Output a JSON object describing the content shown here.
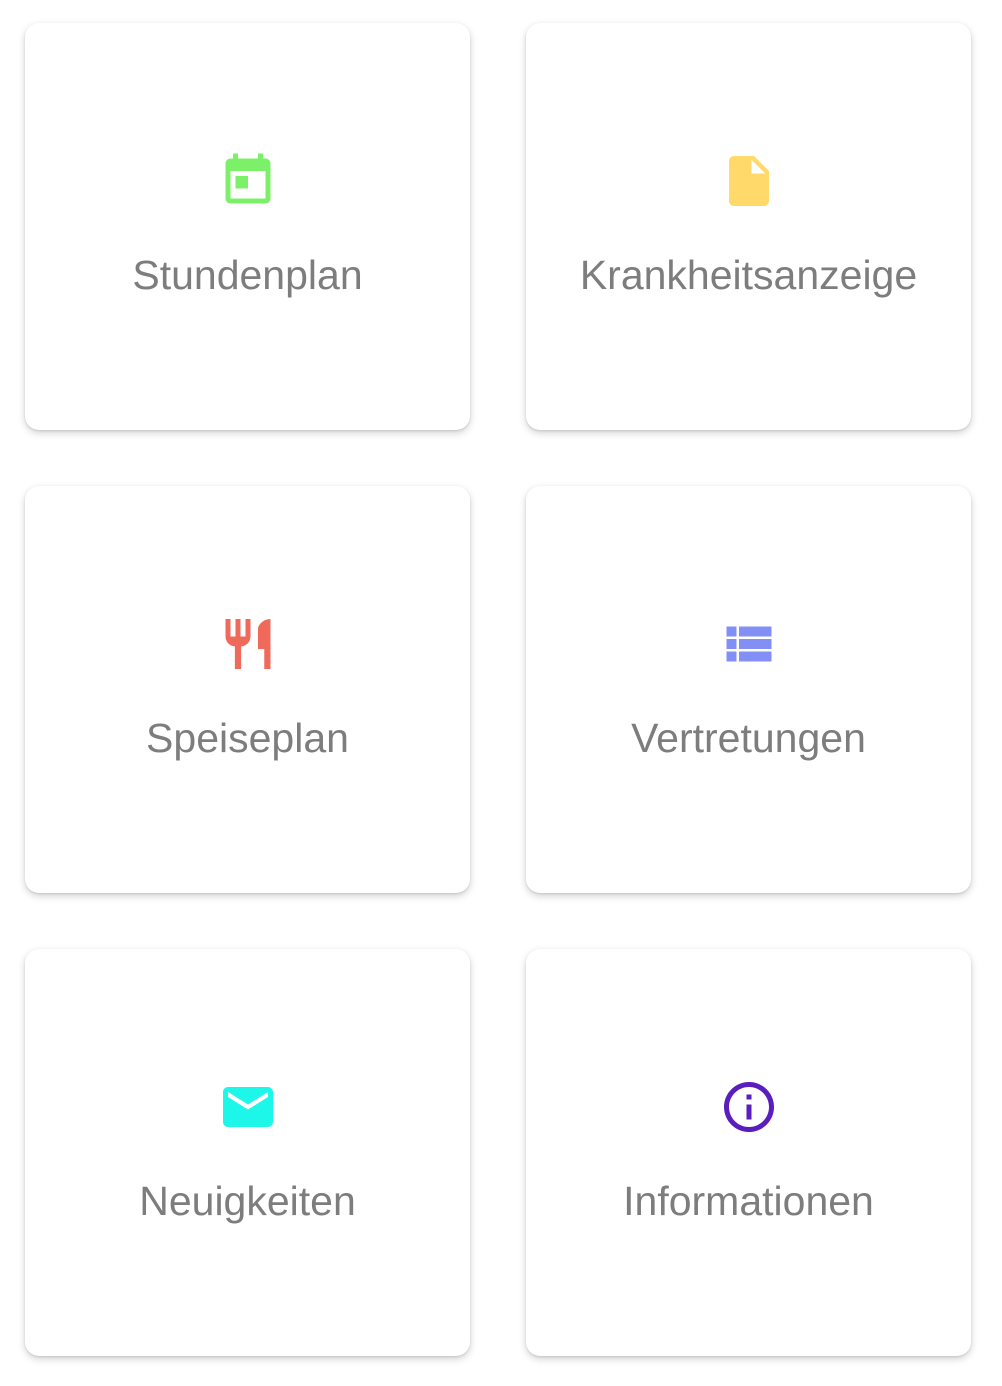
{
  "tiles": [
    {
      "label": "Stundenplan",
      "icon": "calendar-icon",
      "color": "#7CF069"
    },
    {
      "label": "Krankheitsanzeige",
      "icon": "document-icon",
      "color": "#FFD969"
    },
    {
      "label": "Speiseplan",
      "icon": "restaurant-icon",
      "color": "#F06A5C"
    },
    {
      "label": "Vertretungen",
      "icon": "list-icon",
      "color": "#8290F5"
    },
    {
      "label": "Neuigkeiten",
      "icon": "mail-icon",
      "color": "#1DF7E9"
    },
    {
      "label": "Informationen",
      "icon": "info-icon",
      "color": "#5A1DBE"
    }
  ]
}
